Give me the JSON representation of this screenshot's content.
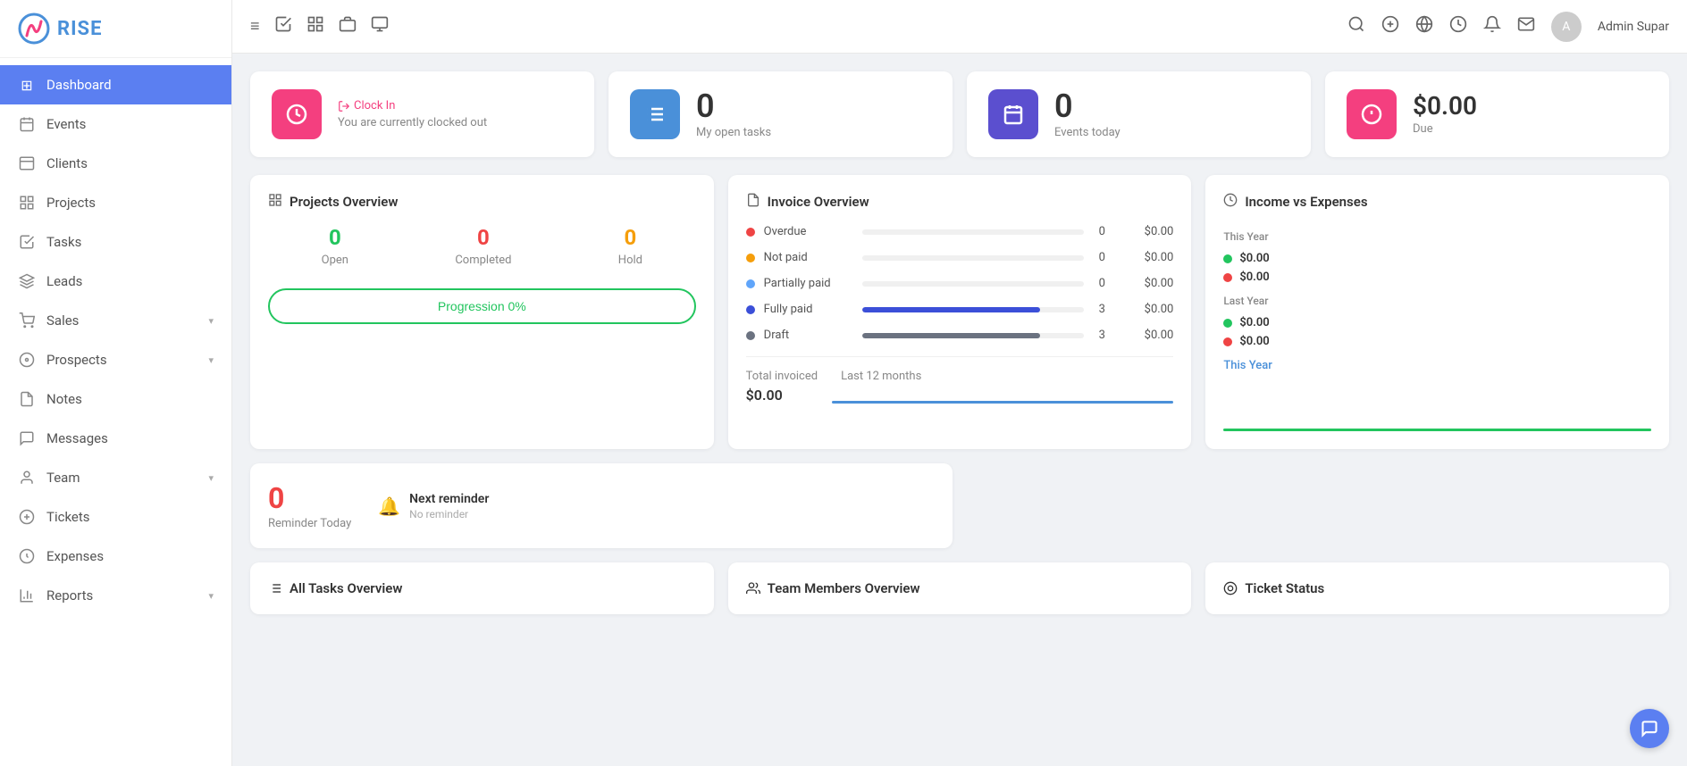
{
  "sidebar": {
    "logo_text": "RISE",
    "items": [
      {
        "id": "dashboard",
        "label": "Dashboard",
        "icon": "⊞",
        "active": true,
        "has_arrow": false
      },
      {
        "id": "events",
        "label": "Events",
        "icon": "🗓",
        "active": false,
        "has_arrow": false
      },
      {
        "id": "clients",
        "label": "Clients",
        "icon": "📋",
        "active": false,
        "has_arrow": false
      },
      {
        "id": "projects",
        "label": "Projects",
        "icon": "⊞",
        "active": false,
        "has_arrow": false
      },
      {
        "id": "tasks",
        "label": "Tasks",
        "icon": "✓",
        "active": false,
        "has_arrow": false
      },
      {
        "id": "leads",
        "label": "Leads",
        "icon": "◈",
        "active": false,
        "has_arrow": false
      },
      {
        "id": "sales",
        "label": "Sales",
        "icon": "🛒",
        "active": false,
        "has_arrow": true
      },
      {
        "id": "prospects",
        "label": "Prospects",
        "icon": "⚓",
        "active": false,
        "has_arrow": true
      },
      {
        "id": "notes",
        "label": "Notes",
        "icon": "📄",
        "active": false,
        "has_arrow": false
      },
      {
        "id": "messages",
        "label": "Messages",
        "icon": "💬",
        "active": false,
        "has_arrow": false
      },
      {
        "id": "team",
        "label": "Team",
        "icon": "👤",
        "active": false,
        "has_arrow": true
      },
      {
        "id": "tickets",
        "label": "Tickets",
        "icon": "🎫",
        "active": false,
        "has_arrow": false
      },
      {
        "id": "expenses",
        "label": "Expenses",
        "icon": "↻",
        "active": false,
        "has_arrow": false
      },
      {
        "id": "reports",
        "label": "Reports",
        "icon": "⏱",
        "active": false,
        "has_arrow": true
      }
    ]
  },
  "topbar": {
    "icons": [
      "≡",
      "✓",
      "⊞",
      "⊟",
      "🖥"
    ],
    "right_icons": [
      "🔍",
      "⊕",
      "🌐",
      "⏱",
      "🔔",
      "✉"
    ],
    "admin_name": "Admin Supar"
  },
  "stats": [
    {
      "id": "clock",
      "icon": "⏱",
      "icon_style": "pink",
      "link_text": "Clock In",
      "sub_text": "You are currently clocked out",
      "type": "clock"
    },
    {
      "id": "tasks",
      "icon": "≡",
      "icon_style": "blue",
      "number": "0",
      "label": "My open tasks",
      "type": "number"
    },
    {
      "id": "events",
      "icon": "📅",
      "icon_style": "purple",
      "number": "0",
      "label": "Events today",
      "type": "number"
    },
    {
      "id": "due",
      "icon": "◉",
      "icon_style": "pink2",
      "number": "$0.00",
      "label": "Due",
      "type": "number"
    }
  ],
  "projects_overview": {
    "title": "Projects Overview",
    "open": {
      "value": "0",
      "label": "Open"
    },
    "completed": {
      "value": "0",
      "label": "Completed"
    },
    "hold": {
      "value": "0",
      "label": "Hold"
    },
    "progression_label": "Progression 0%"
  },
  "reminder": {
    "count": "0",
    "label": "Reminder Today",
    "next_title": "Next reminder",
    "next_sub": "No reminder"
  },
  "invoice_overview": {
    "title": "Invoice Overview",
    "rows": [
      {
        "label": "Overdue",
        "color": "#ef4444",
        "bar_width": "0%",
        "bar_color": "#ef4444",
        "count": "0",
        "amount": "$0.00"
      },
      {
        "label": "Not paid",
        "color": "#f59e0b",
        "bar_width": "0%",
        "bar_color": "#f59e0b",
        "count": "0",
        "amount": "$0.00"
      },
      {
        "label": "Partially paid",
        "color": "#60a5fa",
        "bar_width": "0%",
        "bar_color": "#60a5fa",
        "count": "0",
        "amount": "$0.00"
      },
      {
        "label": "Fully paid",
        "color": "#3b4fd8",
        "bar_width": "80%",
        "bar_color": "#3b4fd8",
        "count": "3",
        "amount": "$0.00"
      },
      {
        "label": "Draft",
        "color": "#6b7280",
        "bar_width": "80%",
        "bar_color": "#6b7280",
        "count": "3",
        "amount": "$0.00"
      }
    ],
    "total_label": "Total invoiced",
    "total_period": "Last 12 months",
    "total_amount": "$0.00"
  },
  "income_expenses": {
    "title": "Income vs Expenses",
    "this_year_label": "This Year",
    "this_year_income": "$0.00",
    "this_year_expense": "$0.00",
    "last_year_label": "Last Year",
    "last_year_income": "$0.00",
    "last_year_expense": "$0.00",
    "chart_label": "This Year"
  },
  "all_tasks": {
    "title": "All Tasks Overview"
  },
  "team_members": {
    "title": "Team Members Overview"
  },
  "ticket_status": {
    "title": "Ticket Status"
  }
}
